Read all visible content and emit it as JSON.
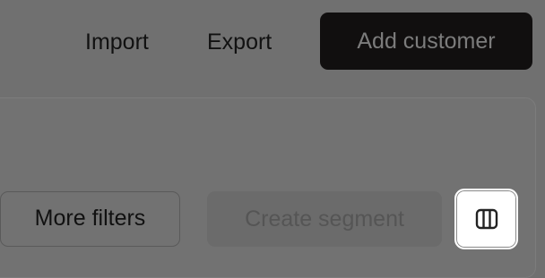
{
  "header": {
    "import_label": "Import",
    "export_label": "Export",
    "add_customer_label": "Add customer"
  },
  "toolbar": {
    "more_filters_label": "More filters",
    "create_segment_label": "Create segment",
    "columns_icon": "columns-icon"
  },
  "colors": {
    "primary_button_bg": "#110f0f",
    "overlay_bg": "#707070",
    "highlight_bg": "#ffffff"
  }
}
